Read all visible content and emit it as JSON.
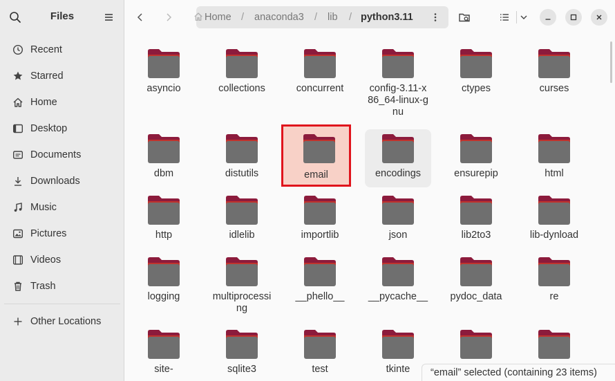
{
  "app": {
    "title": "Files"
  },
  "sidebar": {
    "items": [
      {
        "label": "Recent",
        "icon": "clock-icon"
      },
      {
        "label": "Starred",
        "icon": "star-icon"
      },
      {
        "label": "Home",
        "icon": "home-icon"
      },
      {
        "label": "Desktop",
        "icon": "desktop-icon"
      },
      {
        "label": "Documents",
        "icon": "document-icon"
      },
      {
        "label": "Downloads",
        "icon": "download-icon"
      },
      {
        "label": "Music",
        "icon": "music-icon"
      },
      {
        "label": "Pictures",
        "icon": "picture-icon"
      },
      {
        "label": "Videos",
        "icon": "video-icon"
      },
      {
        "label": "Trash",
        "icon": "trash-icon"
      }
    ],
    "other_locations": "Other Locations"
  },
  "path": {
    "crumbs": [
      "Home",
      "anaconda3",
      "lib",
      "python3.11"
    ],
    "separator": "/"
  },
  "folders": [
    {
      "name": "asyncio"
    },
    {
      "name": "collections"
    },
    {
      "name": "concurrent"
    },
    {
      "name": "config-3.11-x86_64-linux-gnu"
    },
    {
      "name": "ctypes"
    },
    {
      "name": "curses"
    },
    {
      "name": "dbm"
    },
    {
      "name": "distutils"
    },
    {
      "name": "email",
      "selected": true
    },
    {
      "name": "encodings",
      "hover": true
    },
    {
      "name": "ensurepip"
    },
    {
      "name": "html"
    },
    {
      "name": "http"
    },
    {
      "name": "idlelib"
    },
    {
      "name": "importlib"
    },
    {
      "name": "json"
    },
    {
      "name": "lib2to3"
    },
    {
      "name": "lib-dynload"
    },
    {
      "name": "logging"
    },
    {
      "name": "multiprocessing"
    },
    {
      "name": "__phello__"
    },
    {
      "name": "__pycache__"
    },
    {
      "name": "pydoc_data"
    },
    {
      "name": "re"
    },
    {
      "name": "site-"
    },
    {
      "name": "sqlite3"
    },
    {
      "name": "test"
    },
    {
      "name": "tkinte"
    },
    {
      "name": ""
    },
    {
      "name": ""
    }
  ],
  "status": {
    "text": "“email” selected  (containing 23 items)"
  },
  "colors": {
    "folder_body": "#6f6f6f",
    "folder_tab": "#8c1b3c",
    "folder_top": "#c0322d",
    "selection": "#e0141c"
  }
}
